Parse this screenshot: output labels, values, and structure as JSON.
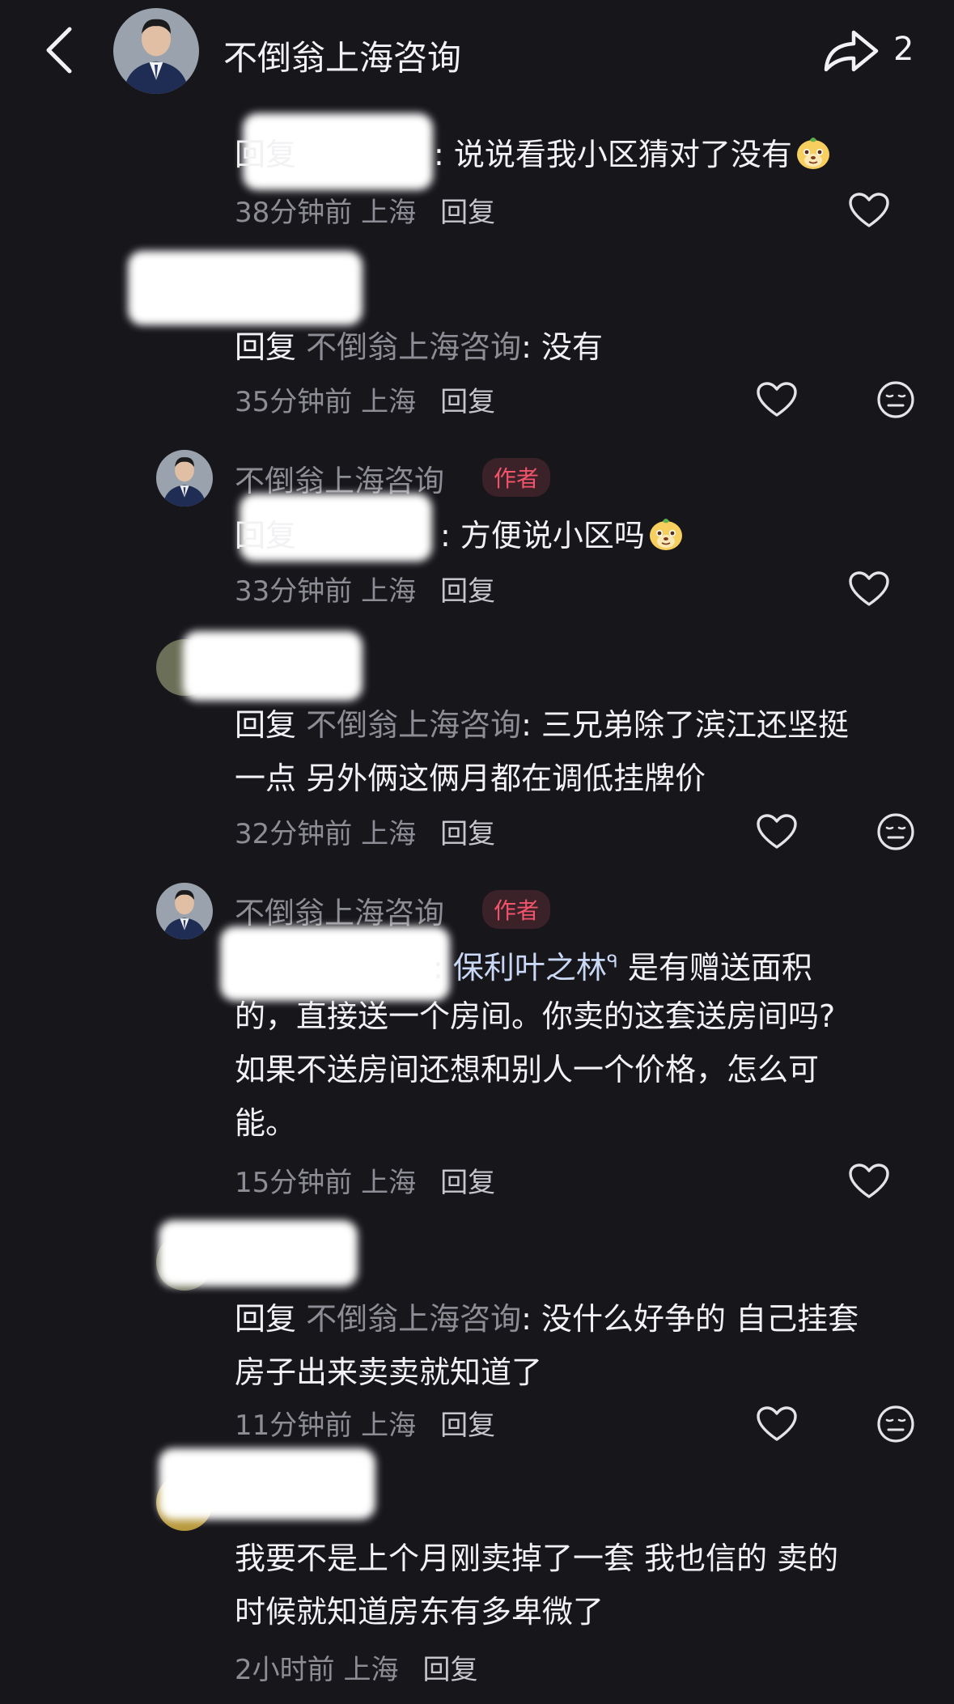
{
  "header": {
    "title": "不倒翁上海咨询",
    "share_count": "2"
  },
  "labels": {
    "reply_prefix": "回复",
    "author_badge": "作者",
    "reply_action": "回复",
    "separator": ":"
  },
  "comments": [
    {
      "text": "说说看我小区猜对了没有",
      "time": "38分钟前",
      "location": "上海"
    },
    {
      "reply_to": "不倒翁上海咨询",
      "text": "没有",
      "time": "35分钟前",
      "location": "上海"
    },
    {
      "user": "不倒翁上海咨询",
      "text": "方便说小区吗",
      "time": "33分钟前",
      "location": "上海"
    },
    {
      "reply_to": "不倒翁上海咨询",
      "text_line1": "三兄弟除了滨江还坚挺",
      "text_line2": "一点 另外俩这俩月都在调低挂牌价",
      "time": "32分钟前",
      "location": "上海"
    },
    {
      "user": "不倒翁上海咨询",
      "link": "保利叶之林",
      "text_line1": "是有赠送面积",
      "text_line2": "的，直接送一个房间。你卖的这套送房间吗?",
      "text_line3": "如果不送房间还想和别人一个价格，怎么可",
      "text_line4": "能。",
      "time": "15分钟前",
      "location": "上海"
    },
    {
      "reply_to": "不倒翁上海咨询",
      "text_line1": "没什么好争的 自己挂套",
      "text_line2": "房子出来卖卖就知道了",
      "time": "11分钟前",
      "location": "上海"
    },
    {
      "text_line1": "我要不是上个月刚卖掉了一套 我也信的 卖的",
      "text_line2": "时候就知道房东有多卑微了",
      "time": "2小时前",
      "location": "上海"
    }
  ],
  "colors": {
    "background": "#17161b",
    "muted": "#8d8d95",
    "author_badge": "#f2546b"
  },
  "icons": [
    "back-arrow-icon",
    "share-icon",
    "heart-icon",
    "neutral-face-icon",
    "dog-emoji-icon"
  ]
}
